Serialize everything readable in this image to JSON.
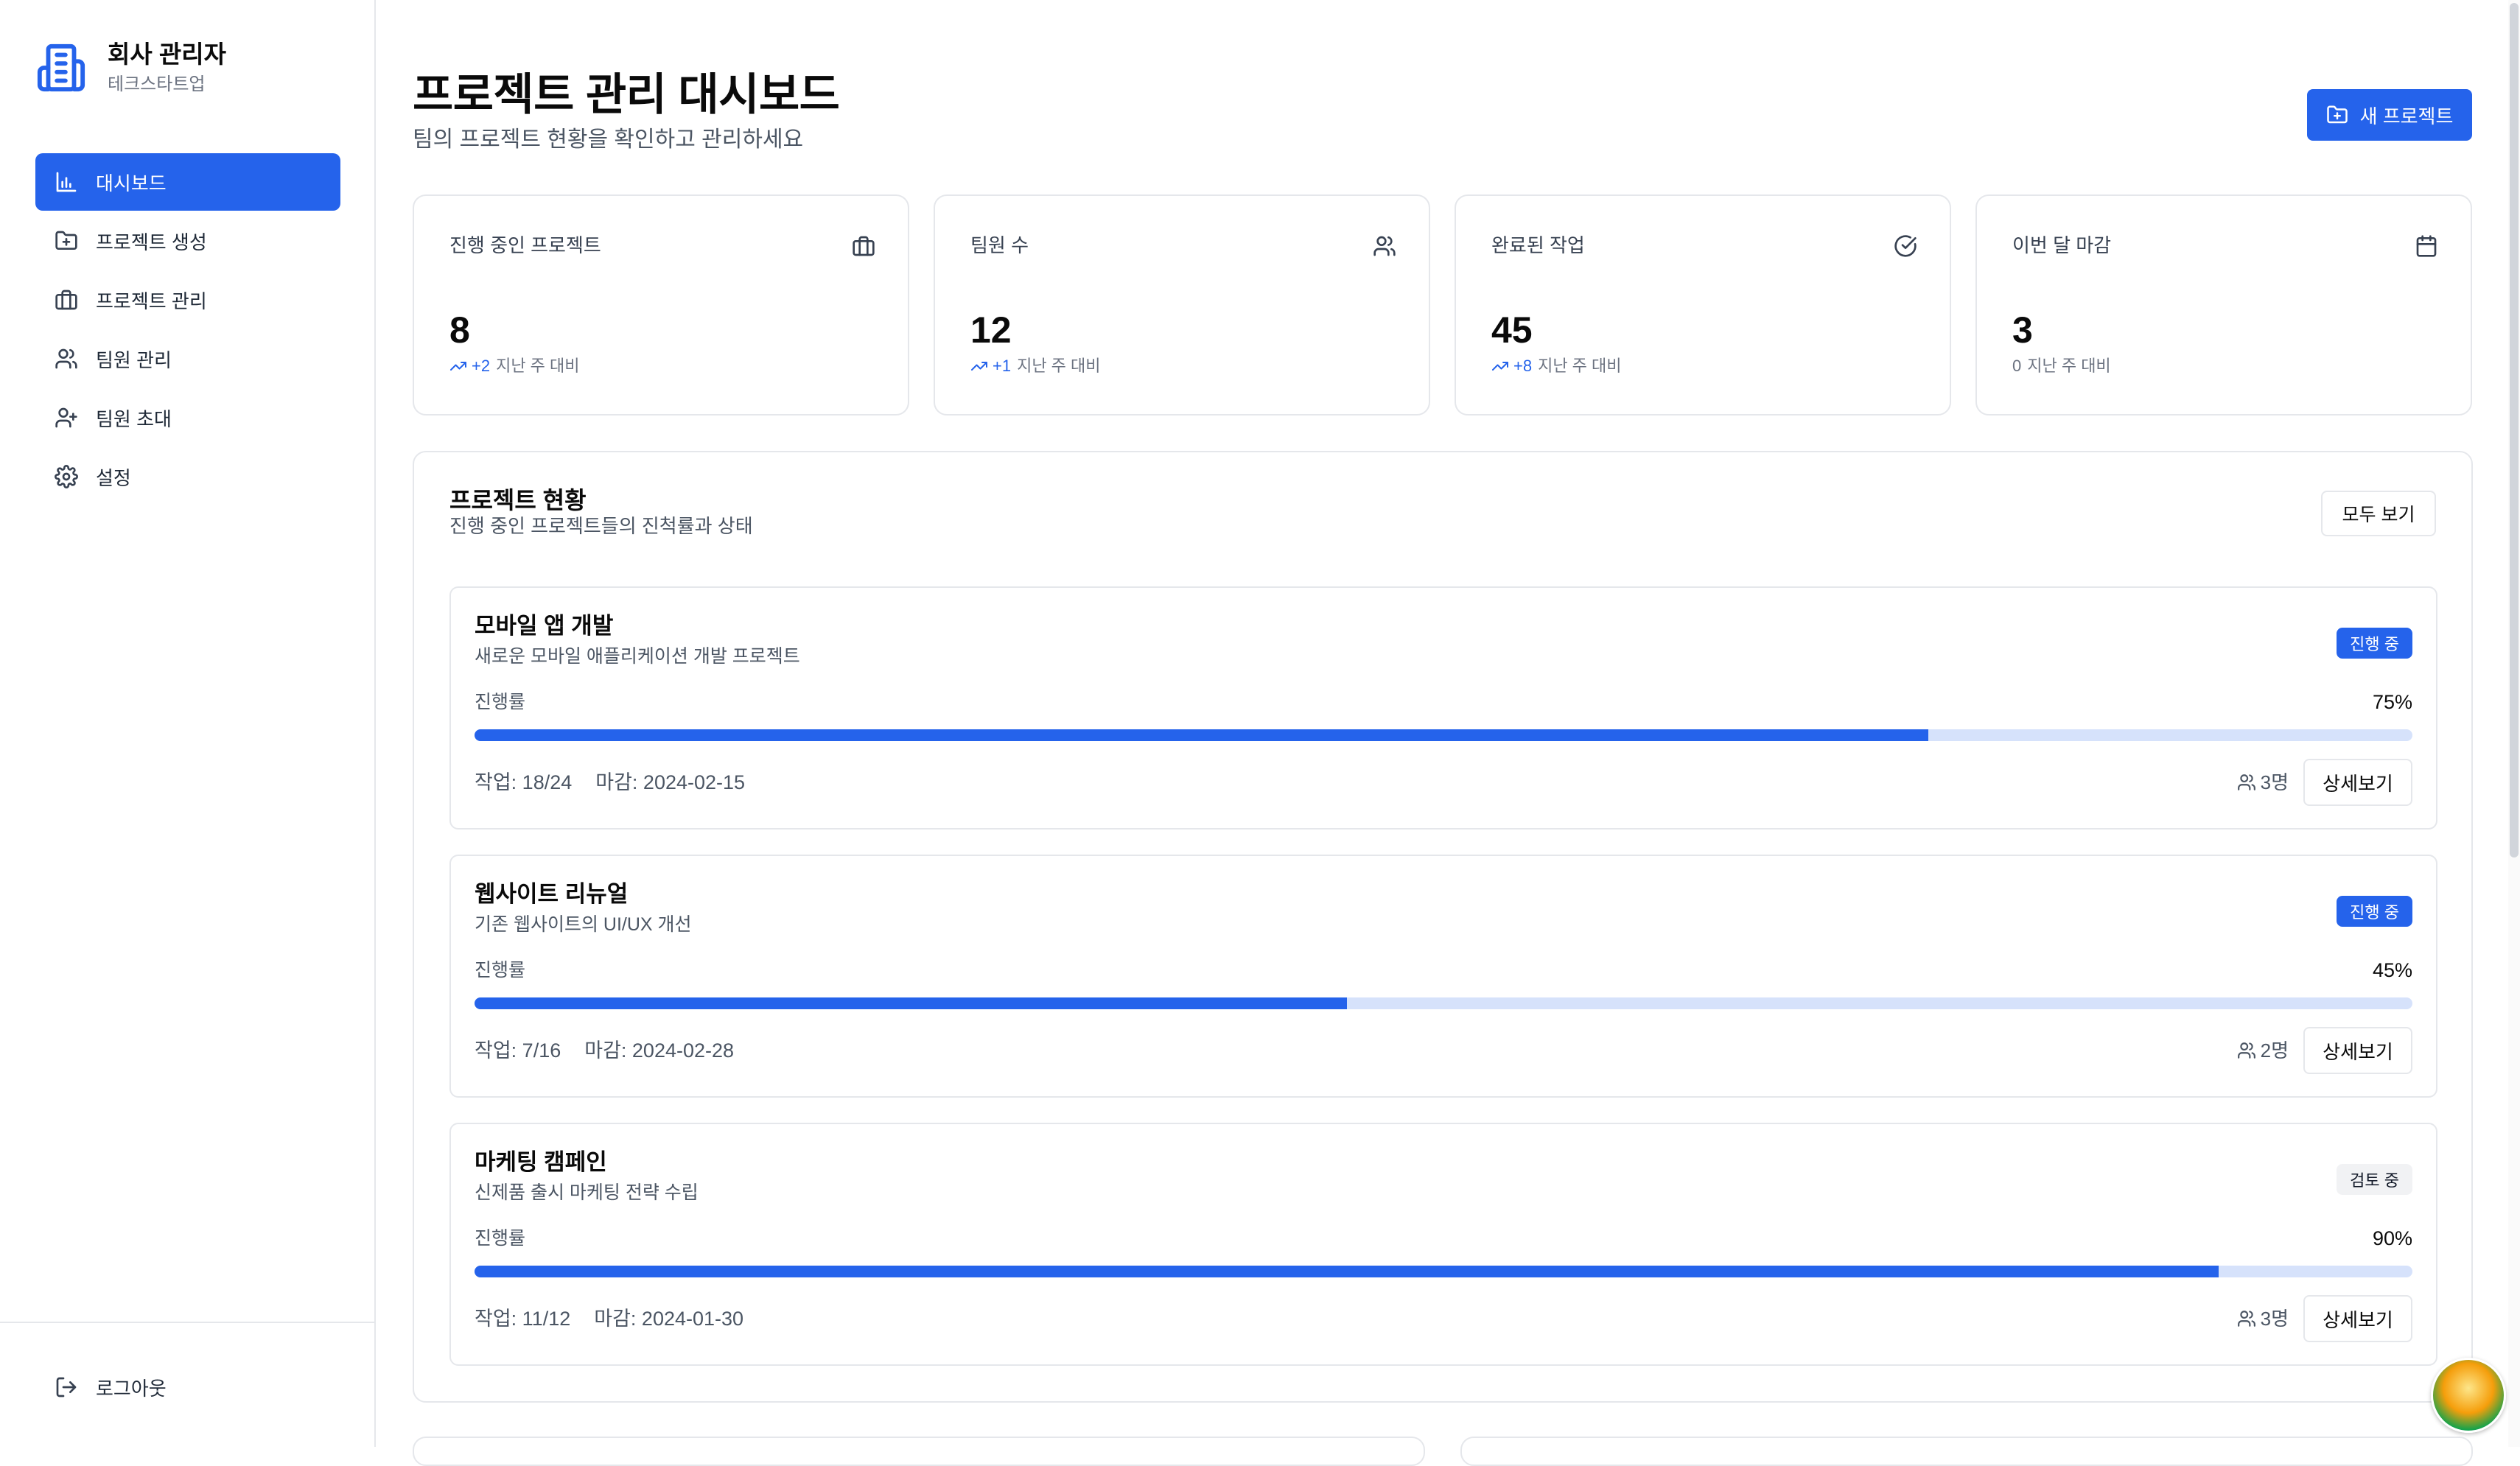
{
  "sidebar": {
    "brand_name": "회사 관리자",
    "brand_sub": "테크스타트업",
    "items": [
      {
        "label": "대시보드",
        "icon": "bar-chart-icon",
        "active": true
      },
      {
        "label": "프로젝트 생성",
        "icon": "folder-plus-icon"
      },
      {
        "label": "프로젝트 관리",
        "icon": "briefcase-icon"
      },
      {
        "label": "팀원 관리",
        "icon": "users-icon"
      },
      {
        "label": "팀원 초대",
        "icon": "user-plus-icon"
      },
      {
        "label": "설정",
        "icon": "gear-icon"
      }
    ],
    "logout_label": "로그아웃"
  },
  "header": {
    "title": "프로젝트 관리 대시보드",
    "subtitle": "팀의 프로젝트 현황을 확인하고 관리하세요",
    "new_project_label": "새 프로젝트"
  },
  "stats": [
    {
      "label": "진행 중인 프로젝트",
      "value": "8",
      "delta": "+2",
      "delta_suffix": "지난 주 대비",
      "icon": "briefcase-icon"
    },
    {
      "label": "팀원 수",
      "value": "12",
      "delta": "+1",
      "delta_suffix": "지난 주 대비",
      "icon": "users-icon"
    },
    {
      "label": "완료된 작업",
      "value": "45",
      "delta": "+8",
      "delta_suffix": "지난 주 대비",
      "icon": "check-circle-icon"
    },
    {
      "label": "이번 달 마감",
      "value": "3",
      "delta": "0",
      "delta_suffix": "지난 주 대비",
      "icon": "calendar-icon"
    }
  ],
  "projects_panel": {
    "title": "프로젝트 현황",
    "subtitle": "진행 중인 프로젝트들의 진척률과 상태",
    "view_all_label": "모두 보기",
    "progress_label": "진행률",
    "detail_label": "상세보기",
    "items": [
      {
        "name": "모바일 앱 개발",
        "desc": "새로운 모바일 애플리케이션 개발 프로젝트",
        "status": "진행 중",
        "progress": 75,
        "progress_text": "75%",
        "tasks": "작업: 18/24",
        "due": "마감: 2024-02-15",
        "members": "3명"
      },
      {
        "name": "웹사이트 리뉴얼",
        "desc": "기존 웹사이트의 UI/UX 개선",
        "status": "진행 중",
        "progress": 45,
        "progress_text": "45%",
        "tasks": "작업: 7/16",
        "due": "마감: 2024-02-28",
        "members": "2명"
      },
      {
        "name": "마케팅 캠페인",
        "desc": "신제품 출시 마케팅 전략 수립",
        "status": "검토 중",
        "progress": 90,
        "progress_text": "90%",
        "tasks": "작업: 11/12",
        "due": "마감: 2024-01-30",
        "members": "3명"
      }
    ]
  },
  "colors": {
    "accent": "#2563eb",
    "track": "#d6e2fb",
    "border": "#e5e7eb"
  }
}
